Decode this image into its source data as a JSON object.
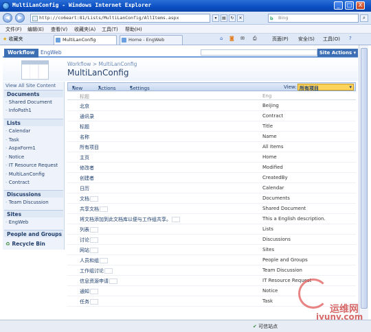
{
  "window": {
    "title": "MultiLanConfig - Windows Internet Explorer",
    "controls": [
      "_",
      "□",
      "X"
    ]
  },
  "address_bar": {
    "url": "http://co6eart:81/Lists/MultiLanConfig/AllItems.aspx",
    "search_engine": "b",
    "search_placeholder": "Bing"
  },
  "menu": [
    "文件(F)",
    "编辑(E)",
    "查看(V)",
    "收藏夹(A)",
    "工具(T)",
    "帮助(H)"
  ],
  "favorites_label": "收藏夹",
  "tabs": [
    {
      "label": "MultiLanConfig"
    },
    {
      "label": "Home - EngWeb"
    }
  ],
  "commands": [
    "页面(P)",
    "安全(S)",
    "工具(O)"
  ],
  "sharepoint": {
    "top_tabs": [
      "Workflow",
      "EngWeb"
    ],
    "site_actions": "Site Actions",
    "breadcrumb": "Workflow > MultiLanConfig",
    "page_title": "MultiLanConfig",
    "view_all": "View All Site Content"
  },
  "left_nav": {
    "sections": [
      {
        "title": "Documents",
        "items": [
          "Shared Document",
          "InfoPath1"
        ]
      },
      {
        "title": "Lists",
        "items": [
          "Calendar",
          "Task",
          "AspxForm1",
          "Notice",
          "IT Resource Request",
          "MultiLanConfig",
          "Contract"
        ]
      },
      {
        "title": "Discussions",
        "items": [
          "Team Discussion"
        ]
      },
      {
        "title": "Sites",
        "items": [
          "EngWeb"
        ]
      },
      {
        "title": "People and Groups",
        "items": []
      }
    ],
    "recycle_bin": "Recycle Bin"
  },
  "toolbar": {
    "new": "New",
    "actions": "Actions",
    "settings": "Settings",
    "view_label": "View:",
    "view_value": "所有项目"
  },
  "list": {
    "headers": [
      "标题",
      "Eng"
    ],
    "rows": [
      {
        "title": "北京",
        "eng": "Beijing"
      },
      {
        "title": "通讯录",
        "eng": "Contract"
      },
      {
        "title": "标题",
        "eng": "Title"
      },
      {
        "title": "名称",
        "eng": "Name"
      },
      {
        "title": "所有项目",
        "eng": "All Items"
      },
      {
        "title": "主页",
        "eng": "Home"
      },
      {
        "title": "修改者",
        "eng": "Modified"
      },
      {
        "title": "创建者",
        "eng": "CreatedBy"
      },
      {
        "title": "日历",
        "eng": "Calendar"
      },
      {
        "title": "文档",
        "eng": "Documents"
      },
      {
        "title": "共享文档",
        "eng": "Shared Document"
      },
      {
        "title": "将文档添加到此文档库以便与工作组共享。",
        "eng": "This a English description."
      },
      {
        "title": "列表",
        "eng": "Lists"
      },
      {
        "title": "讨论",
        "eng": "Discussions"
      },
      {
        "title": "网站",
        "eng": "Sites"
      },
      {
        "title": "人员和组",
        "eng": "People and Groups"
      },
      {
        "title": "工作组讨论",
        "eng": "Team Discussion"
      },
      {
        "title": "信息资源申请",
        "eng": "IT Resource Request"
      },
      {
        "title": "通知",
        "eng": "Notice"
      },
      {
        "title": "任务",
        "eng": "Task"
      }
    ]
  },
  "status": {
    "zone": "可信站点"
  },
  "watermark": {
    "cn": "运维网",
    "en": "iyunv.com"
  }
}
